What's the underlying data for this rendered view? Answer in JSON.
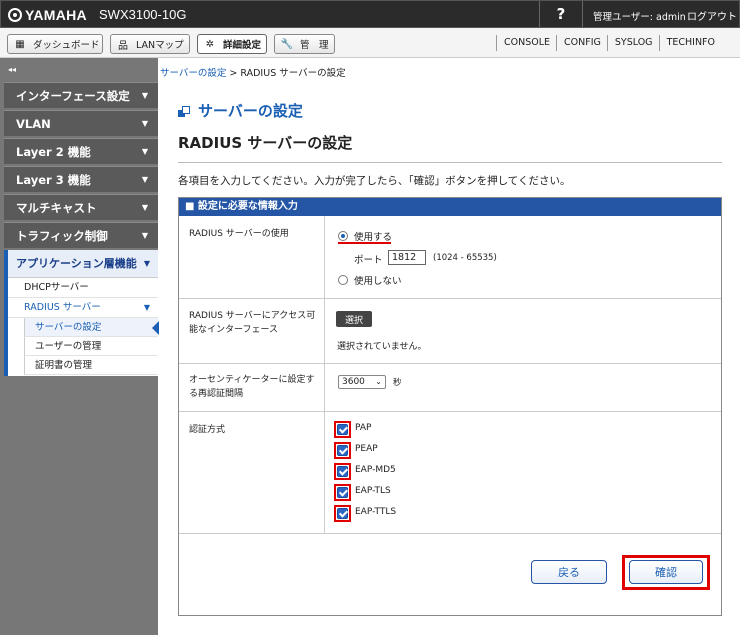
{
  "app": {
    "brand": "YAMAHA",
    "model": "SWX3100-10G",
    "help": "?",
    "user": "管理ユーザー: admin",
    "logout": "ログアウト"
  },
  "nav": {
    "dashboard": "ダッシュボード",
    "lanmap": "LANマップ",
    "detail": "詳細設定",
    "manage": "管　理",
    "right_links": [
      "CONSOLE",
      "CONFIG",
      "SYSLOG",
      "TECHINFO"
    ]
  },
  "sidebar": {
    "collapse": "◂◂",
    "items": [
      "インターフェース設定",
      "VLAN",
      "Layer 2 機能",
      "Layer 3 機能",
      "マルチキャスト",
      "トラフィック制御"
    ],
    "open": {
      "label": "アプリケーション層機能",
      "subs": [
        "DHCPサーバー",
        "RADIUS サーバー"
      ],
      "subsubs": [
        "サーバーの設定",
        "ユーザーの管理",
        "証明書の管理"
      ]
    }
  },
  "breadcrumb": {
    "link": "サーバーの設定",
    "sep": " > ",
    "current": "RADIUS サーバーの設定"
  },
  "section_title": "サーバーの設定",
  "page_title": "RADIUS サーバーの設定",
  "intro": "各項目を入力してください。入力が完了したら、「確認」ボタンを押してください。",
  "panel": {
    "header": "■ 設定に必要な情報入力",
    "use": {
      "label": "RADIUS サーバーの使用",
      "opt_on": "使用する",
      "port_label": "ポート",
      "port_value": "1812",
      "port_range": "(1024 - 65535)",
      "opt_off": "使用しない",
      "selected": "使用する"
    },
    "iface": {
      "label_line1": "RADIUS サーバーにアクセス可",
      "label_line2": "能なインターフェース",
      "select_btn": "選択",
      "status": "選択されていません。"
    },
    "reauth": {
      "label_line1": "オーセンティケーターに設定す",
      "label_line2": "る再認証間隔",
      "value": "3600",
      "unit": "秒"
    },
    "auth": {
      "label": "認証方式",
      "methods": [
        "PAP",
        "PEAP",
        "EAP-MD5",
        "EAP-TLS",
        "EAP-TTLS"
      ],
      "checked": [
        true,
        true,
        true,
        true,
        true
      ]
    }
  },
  "buttons": {
    "back": "戻る",
    "confirm": "確認"
  },
  "colors": {
    "accent": "#1a5fb4",
    "panel_header": "#2556a6",
    "highlight": "#e00000"
  }
}
